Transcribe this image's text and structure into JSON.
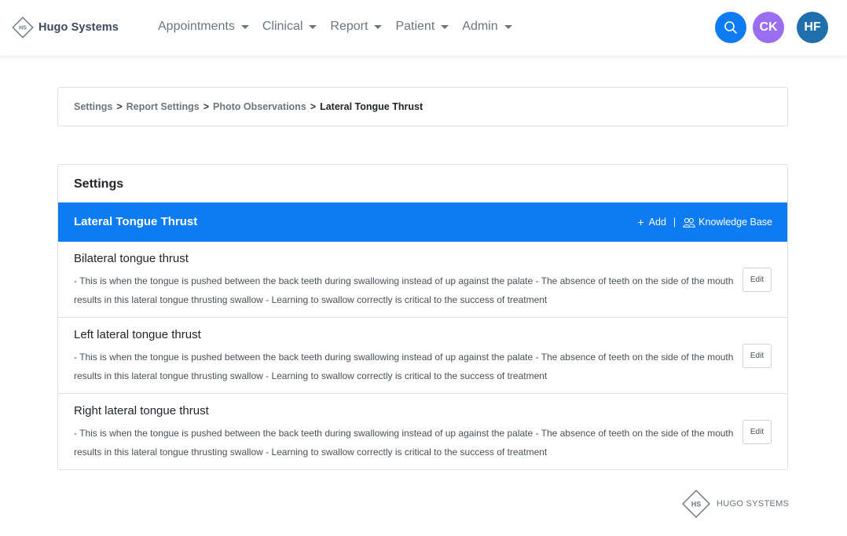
{
  "brand": {
    "logo_initials": "HS",
    "name": "Hugo Systems"
  },
  "nav": {
    "items": [
      {
        "label": "Appointments"
      },
      {
        "label": "Clinical"
      },
      {
        "label": "Report"
      },
      {
        "label": "Patient"
      },
      {
        "label": "Admin"
      }
    ]
  },
  "header": {
    "search_icon": "search-icon",
    "user_avatars": [
      {
        "initials": "CK",
        "color": "#9b6ef0"
      },
      {
        "initials": "HF",
        "color": "#1f6fad"
      }
    ]
  },
  "breadcrumb": {
    "items": [
      "Settings",
      "Report Settings",
      "Photo Observations"
    ],
    "separator": ">",
    "current": "Lateral Tongue Thrust"
  },
  "settings": {
    "title": "Settings",
    "section_title": "Lateral Tongue Thrust",
    "add_label": "Add",
    "divider": "|",
    "knowledge_base_label": "Knowledge Base",
    "edit_label": "Edit",
    "observations": [
      {
        "title": "Bilateral tongue thrust",
        "description": "- This is when the tongue is pushed between the back teeth during swallowing instead of up against the palate - The absence of teeth on the side of the mouth results in this lateral tongue thrusting swallow - Learning to swallow correctly is critical to the success of treatment"
      },
      {
        "title": "Left lateral tongue thrust",
        "description": "- This is when the tongue is pushed between the back teeth during swallowing instead of up against the palate - The absence of teeth on the side of the mouth results in this lateral tongue thrusting swallow - Learning to swallow correctly is critical to the success of treatment"
      },
      {
        "title": "Right lateral tongue thrust",
        "description": "- This is when the tongue is pushed between the back teeth during swallowing instead of up against the palate - The absence of teeth on the side of the mouth results in this lateral tongue thrusting swallow - Learning to swallow correctly is critical to the success of treatment"
      }
    ]
  },
  "footer": {
    "logo_initials": "HS",
    "text": "HUGO SYSTEMS"
  },
  "colors": {
    "primary": "#0d7cf2",
    "avatar_ck": "#9b6ef0",
    "avatar_hf": "#1f6fad"
  }
}
